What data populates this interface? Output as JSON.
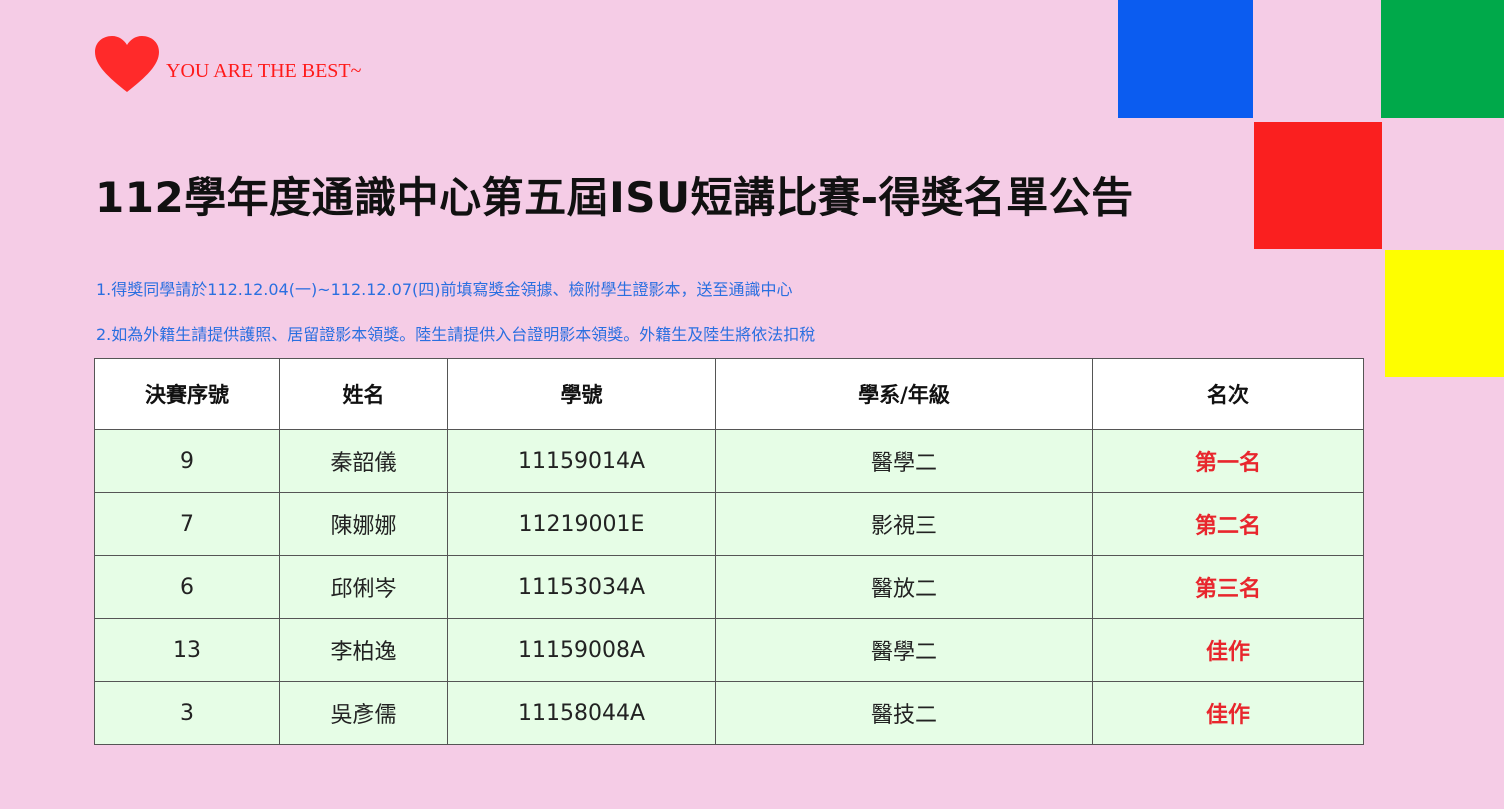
{
  "header": {
    "slogan": "YOU ARE THE BEST~",
    "title": "112學年度通識中心第五屆ISU短講比賽-得獎名單公告",
    "heart_icon": "heart-icon"
  },
  "notes": [
    "1.得獎同學請於112.12.04(一)~112.12.07(四)前填寫獎金領據、檢附學生證影本，送至通識中心",
    "2.如為外籍生請提供護照、居留證影本領獎。陸生請提供入台證明影本領獎。外籍生及陸生將依法扣稅"
  ],
  "table": {
    "headers": [
      "決賽序號",
      "姓名",
      "學號",
      "學系/年級",
      "名次"
    ],
    "rows": [
      [
        "9",
        "秦韶儀",
        "11159014A",
        "醫學二",
        "第一名"
      ],
      [
        "7",
        "陳娜娜",
        "11219001E",
        "影視三",
        "第二名"
      ],
      [
        "6",
        "邱俐岑",
        "11153034A",
        "醫放二",
        "第三名"
      ],
      [
        "13",
        "李柏逸",
        "11159008A",
        "醫學二",
        "佳作"
      ],
      [
        "3",
        "吳彥儒",
        "11158044A",
        "醫技二",
        "佳作"
      ]
    ]
  },
  "colors": {
    "background": "#f5cce6",
    "heart": "#ff2a2a",
    "slogan": "#ff1a1a",
    "notes": "#2a6fe0",
    "rank": "#e8262d",
    "row_background": "#e6fde6",
    "block_blue": "#0b5cf0",
    "block_green": "#00a94a",
    "block_red": "#fa1f1f",
    "block_yellow": "#fefe00"
  }
}
